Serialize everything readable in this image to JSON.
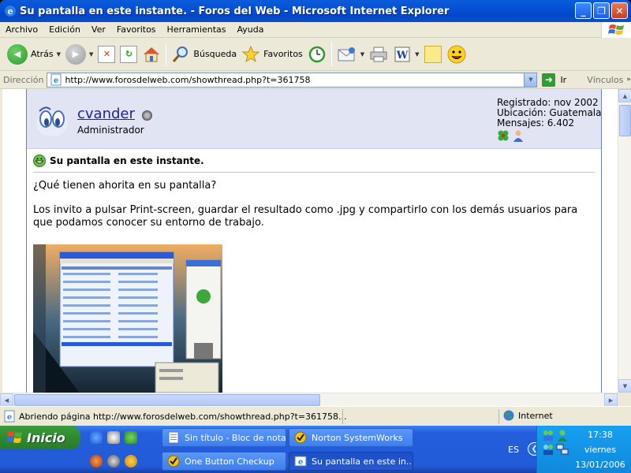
{
  "window": {
    "title": "Su pantalla en este instante. - Foros del Web - Microsoft Internet Explorer",
    "controls": {
      "minimize": "_",
      "maximize": "❐",
      "close": "✕"
    }
  },
  "menu": [
    "Archivo",
    "Edición",
    "Ver",
    "Favoritos",
    "Herramientas",
    "Ayuda"
  ],
  "toolbar": {
    "back": "Atrás",
    "search": "Búsqueda",
    "favorites": "Favoritos"
  },
  "address": {
    "label": "Dirección",
    "url": "http://www.forosdelweb.com/showthread.php?t=361758",
    "go": "Ir",
    "links": "Vínculos"
  },
  "post": {
    "username": "cvander",
    "usertitle": "Administrador",
    "registered": "Registrado: nov 2002",
    "location": "Ubicación: Guatemala",
    "messages": "Mensajes: 6.402",
    "title": "Su pantalla en este instante.",
    "paragraphs": [
      "¿Qué tienen ahorita en su pantalla?",
      "Los invito a pulsar Print-screen, guardar el resultado como .jpg y compartirlo con los demás usuarios para que podamos conocer su entorno de trabajo."
    ]
  },
  "status": {
    "text": "Abriendo página http://www.forosdelweb.com/showthread.php?t=361758...",
    "zone": "Internet"
  },
  "taskbar": {
    "start": "Inicio",
    "tasks": [
      {
        "label": "Sin título - Bloc de notas",
        "active": false
      },
      {
        "label": "Norton SystemWorks",
        "active": false
      },
      {
        "label": "One Button Checkup",
        "active": false
      },
      {
        "label": "Su pantalla en este in...",
        "active": true
      }
    ],
    "lang": "ES",
    "time": "17:38",
    "day": "viernes",
    "date": "13/01/2006"
  },
  "colors": {
    "title_bar": "#0550d6",
    "link": "#22229c",
    "post_header_bg": "#e1e4f2",
    "taskbar": "#245edc",
    "start_green": "#2f8a2f",
    "tray": "#1088dc"
  }
}
